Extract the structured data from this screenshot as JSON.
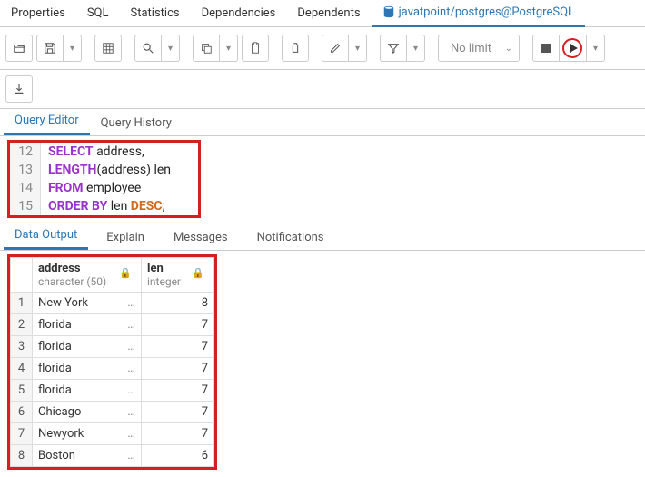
{
  "main_tabs": {
    "properties": "Properties",
    "sql": "SQL",
    "statistics": "Statistics",
    "dependencies": "Dependencies",
    "dependents": "Dependents",
    "connection": "javatpoint/postgres@PostgreSQL"
  },
  "toolbar": {
    "nolimit": "No limit"
  },
  "editor_tabs": {
    "query_editor": "Query Editor",
    "query_history": "Query History"
  },
  "code": {
    "line12_num": "12",
    "line12_kw_select": "SELECT",
    "line12_rest": " address,",
    "line13_num": "13",
    "line13_kw_length": "LENGTH",
    "line13_rest": "(address) len",
    "line14_num": "14",
    "line14_kw_from": "FROM",
    "line14_rest": " employee",
    "line15_num": "15",
    "line15_kw_order": "ORDER BY",
    "line15_mid": " len ",
    "line15_kw_desc": "DESC",
    "line15_semi": ";"
  },
  "results_tabs": {
    "data_output": "Data Output",
    "explain": "Explain",
    "messages": "Messages",
    "notifications": "Notifications"
  },
  "columns": {
    "address_name": "address",
    "address_type": "character (50)",
    "len_name": "len",
    "len_type": "integer"
  },
  "rows": [
    {
      "n": "1",
      "address": "New York",
      "len": "8"
    },
    {
      "n": "2",
      "address": "florida",
      "len": "7"
    },
    {
      "n": "3",
      "address": "florida",
      "len": "7"
    },
    {
      "n": "4",
      "address": "florida",
      "len": "7"
    },
    {
      "n": "5",
      "address": "florida",
      "len": "7"
    },
    {
      "n": "6",
      "address": "Chicago",
      "len": "7"
    },
    {
      "n": "7",
      "address": "Newyork",
      "len": "7"
    },
    {
      "n": "8",
      "address": "Boston",
      "len": "6"
    }
  ]
}
